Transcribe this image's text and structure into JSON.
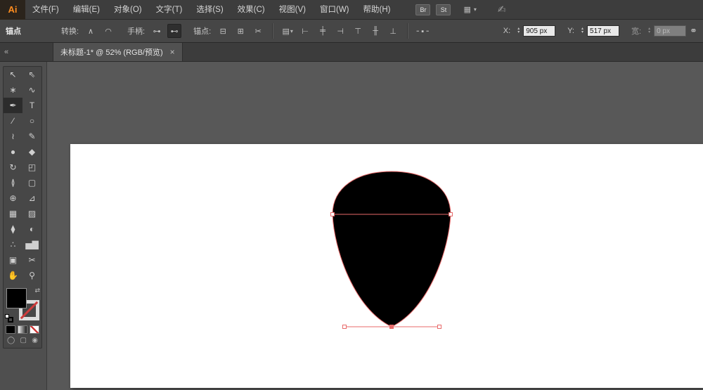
{
  "menubar": {
    "logo": "Ai",
    "items": [
      "文件(F)",
      "编辑(E)",
      "对象(O)",
      "文字(T)",
      "选择(S)",
      "效果(C)",
      "视图(V)",
      "窗口(W)",
      "帮助(H)"
    ],
    "br_button": "Br",
    "st_button": "St",
    "workspace_icon": "▦",
    "workspace_caret": "▾",
    "live_icon": "✍"
  },
  "controlbar": {
    "title": "锚点",
    "convert_label": "转换:",
    "convert_corner_icon": "∧",
    "convert_smooth_icon": "◠",
    "handles_label": "手柄:",
    "handles_show_icon": "⊶",
    "handles_hide_icon": "⊷",
    "anchors_label": "锚点:",
    "anchor_remove_icon": "⊟",
    "anchor_connect_icon": "⊞",
    "anchor_cut_icon": "✂",
    "align_panel_icon": "▤",
    "align_caret": "▾",
    "align_left_icon": "⊢",
    "align_hcenter_icon": "╪",
    "align_right_icon": "⊣",
    "align_top_icon": "⊤",
    "align_vcenter_icon": "╫",
    "align_bottom_icon": "⊥",
    "reference_icon": "╴▪╶",
    "spin_up": "▴",
    "spin_down": "▾",
    "x_label": "X:",
    "x_value": "905 px",
    "y_label": "Y:",
    "y_value": "517 px",
    "w_label": "宽:",
    "w_value": "0 px",
    "link_icon": "⚭"
  },
  "tabbar": {
    "collapse_icon": "«",
    "tab_title": "未标题-1* @ 52% (RGB/预览)",
    "close_icon": "×"
  },
  "tools": [
    {
      "name": "selection-tool",
      "glyph": "↖"
    },
    {
      "name": "direct-selection-tool",
      "glyph": "⇖"
    },
    {
      "name": "magic-wand-tool",
      "glyph": "∗"
    },
    {
      "name": "lasso-tool",
      "glyph": "∿"
    },
    {
      "name": "pen-tool",
      "glyph": "✒",
      "selected": true
    },
    {
      "name": "type-tool",
      "glyph": "T"
    },
    {
      "name": "line-segment-tool",
      "glyph": "∕"
    },
    {
      "name": "ellipse-tool",
      "glyph": "○"
    },
    {
      "name": "paintbrush-tool",
      "glyph": "≀"
    },
    {
      "name": "pencil-tool",
      "glyph": "✎"
    },
    {
      "name": "blob-brush-tool",
      "glyph": "●"
    },
    {
      "name": "eraser-tool",
      "glyph": "◆"
    },
    {
      "name": "rotate-tool",
      "glyph": "↻"
    },
    {
      "name": "scale-tool",
      "glyph": "◰"
    },
    {
      "name": "width-tool",
      "glyph": "≬"
    },
    {
      "name": "free-transform-tool",
      "glyph": "▢"
    },
    {
      "name": "shape-builder-tool",
      "glyph": "⊕"
    },
    {
      "name": "perspective-grid-tool",
      "glyph": "⊿"
    },
    {
      "name": "mesh-tool",
      "glyph": "▦"
    },
    {
      "name": "gradient-tool",
      "glyph": "▨"
    },
    {
      "name": "eyedropper-tool",
      "glyph": "⧫"
    },
    {
      "name": "blend-tool",
      "glyph": "◐"
    },
    {
      "name": "symbol-sprayer-tool",
      "glyph": "∴"
    },
    {
      "name": "column-graph-tool",
      "glyph": "▅▇"
    },
    {
      "name": "artboard-tool",
      "glyph": "▣"
    },
    {
      "name": "slice-tool",
      "glyph": "✂"
    },
    {
      "name": "hand-tool",
      "glyph": "✋"
    },
    {
      "name": "zoom-tool",
      "glyph": "⚲"
    }
  ],
  "toolbox": {
    "swap_icon": "⇄",
    "fill_color": "#000000",
    "draw_normal_icon": "◯",
    "draw_behind_icon": "▢",
    "draw_inside_icon": "◉"
  },
  "canvas": {
    "artboard_color": "#ffffff",
    "shape_color": "#000000",
    "selection_color": "#e86a6a"
  }
}
